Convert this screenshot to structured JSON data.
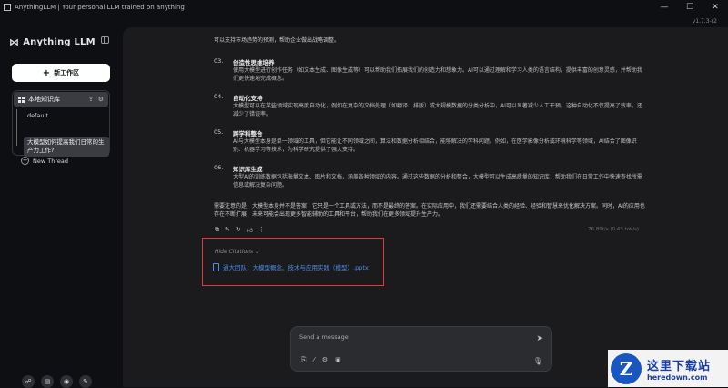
{
  "window": {
    "title": "AnythingLLM | Your personal LLM trained on anything",
    "controls": [
      "—",
      "☐",
      "✕"
    ],
    "version": "v1.7.3-r2"
  },
  "sidebar": {
    "logo": "Anything LLM",
    "new_workspace": "新工作区",
    "workspace": "本地知识库",
    "threads": {
      "default": "default",
      "active": "大模型如何提高我们日常的生产力工作?",
      "new_thread": "New Thread"
    },
    "footer_icons": [
      "community-icon",
      "docs-icon",
      "discord-icon",
      "settings-icon"
    ]
  },
  "chat": {
    "intro_tail": "可以支持市场趋势的预测，帮助企业做出战略调整。",
    "items": [
      {
        "num": "03.",
        "head": "创造性思维培养",
        "body": "使用大模型进行创作任务（如文本生成、图像生成等）可以帮助我们拓展我们的创造力和想象力。AI可以通过理解和学习人类的语言结构，提供丰富的创意灵感，并帮助我们更快速地完成概念。"
      },
      {
        "num": "04.",
        "head": "自动化支持",
        "body": "大模型可以在某些领域实现高度自动化，例如在复杂的文档处理（如翻译、排版）或大规模数据的分类分析中，AI可以显著减少人工干预。这种自动化不仅提高了效率，还减少了错误率。"
      },
      {
        "num": "05.",
        "head": "跨学科整合",
        "body": "AI与大模型本身是单一领域的工具，但它能让不同领域之间，算法和数据分析相结合，能够解决的学科问题。例如，在医学影像分析或环境科学等领域，AI结合了图像识别、机器学习等技术，为科学研究提供了强大支持。"
      },
      {
        "num": "06.",
        "head": "知识库生成",
        "body": "大型AI的训练数据包括海量文本、图片和文档，涵盖各种领域的内容。通过这些数据的分析和整合，大模型可以生成高质量的知识库，帮助我们在日常工作中快速查找所需信息或解决复杂问题。"
      }
    ],
    "conclusion": "需要注意的是，大模型本身并不是答案，它只是一个工具或方法，而不是最终的答案。在实际应用中，我们还需要结合人类的经验、经验和智慧来优化解决方案。同时，AI的应用也存在不断扩展，未来可能会出现更多智能辅助的工具和平台，帮助我们在更多领域提升生产力。",
    "metrics": "76.89t/s (0.43 tok/s)",
    "actions": [
      "copy-icon",
      "edit-icon",
      "regenerate-icon",
      "thumbs-up-icon",
      "more-icon"
    ],
    "citations": {
      "toggle": "Hide Citations",
      "file": "通大团队：大模型概念、技术与应用实践（模型）.pptx"
    }
  },
  "composer": {
    "placeholder": "Send a message"
  },
  "watermark": {
    "cn": "这里下载站",
    "en": "heredown.com",
    "mark": "Z"
  }
}
